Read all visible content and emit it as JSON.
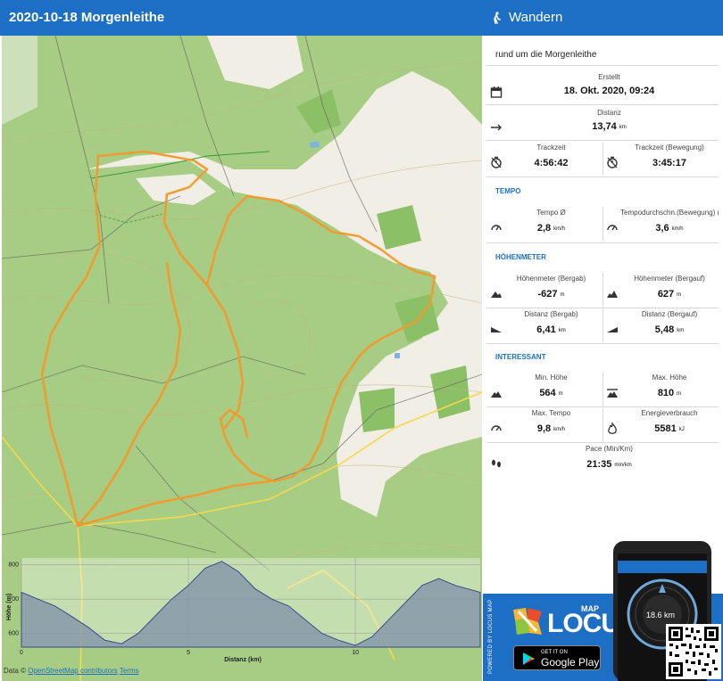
{
  "header": {
    "title": "2020-10-18 Morgenleithe",
    "activity": "Wandern"
  },
  "description": "rund um die Morgenleithe",
  "stats": {
    "created": {
      "label": "Erstellt",
      "value": "18. Okt. 2020, 09:24"
    },
    "distance": {
      "label": "Distanz",
      "value": "13,74",
      "unit": "km"
    },
    "tracktime": {
      "label": "Trackzeit",
      "value": "4:56:42"
    },
    "tracktime_moving": {
      "label": "Trackzeit (Bewegung)",
      "value": "3:45:17"
    }
  },
  "tempo": {
    "section": "TEMPO",
    "tempo": {
      "label": "Tempo Ø",
      "value": "2,8",
      "unit": "km/h"
    },
    "tempo_moving": {
      "label": "Tempodurchschn.(Bewegung) (B.",
      "value": "3,6",
      "unit": "km/h"
    }
  },
  "elevation": {
    "section": "HÖHENMETER",
    "descent": {
      "label": "Höhenmeter (Bergab)",
      "value": "-627",
      "unit": "m"
    },
    "ascent": {
      "label": "Höhenmeter (Bergauf)",
      "value": "627",
      "unit": "m"
    },
    "dist_down": {
      "label": "Distanz (Bergab)",
      "value": "6,41",
      "unit": "km"
    },
    "dist_up": {
      "label": "Distanz (Bergauf)",
      "value": "5,48",
      "unit": "km"
    }
  },
  "interesting": {
    "section": "INTERESSANT",
    "min_alt": {
      "label": "Min. Höhe",
      "value": "564",
      "unit": "m"
    },
    "max_alt": {
      "label": "Max. Höhe",
      "value": "810",
      "unit": "m"
    },
    "max_tempo": {
      "label": "Max. Tempo",
      "value": "9,8",
      "unit": "km/h"
    },
    "energy": {
      "label": "Energieverbrauch",
      "value": "5581",
      "unit": "kJ"
    },
    "pace": {
      "label": "Pace (Min/Km)",
      "value": "21:35",
      "unit": "min/km"
    }
  },
  "chart": {
    "ylabel": "Höhe (m)",
    "xlabel": "Distanz (km)",
    "yticks": [
      "800",
      "700",
      "600"
    ],
    "xticks": [
      "0",
      "5",
      "10"
    ]
  },
  "chart_data": {
    "type": "area",
    "title": "",
    "xlabel": "Distanz (km)",
    "ylabel": "Höhe (m)",
    "ylim": [
      560,
      820
    ],
    "xlim": [
      0,
      13.74
    ],
    "x": [
      0,
      0.5,
      1,
      1.5,
      2,
      2.5,
      3,
      3.5,
      4,
      4.5,
      5,
      5.5,
      6,
      6.5,
      7,
      7.5,
      8,
      8.5,
      9,
      9.5,
      10,
      10.5,
      11,
      11.5,
      12,
      12.5,
      13,
      13.74
    ],
    "values": [
      720,
      700,
      680,
      650,
      618,
      580,
      570,
      600,
      650,
      700,
      740,
      790,
      810,
      780,
      730,
      700,
      680,
      640,
      600,
      580,
      565,
      590,
      640,
      690,
      740,
      760,
      740,
      720
    ]
  },
  "attribution": {
    "prefix": "Data ©",
    "osm": "OpenStreetMap contributors",
    "terms": "Terms"
  },
  "promo": {
    "side_text": "POWERED BY LOCUS MAP",
    "logo": "LOCUS",
    "logo_small": "MAP",
    "store_line1": "GET IT ON",
    "store_line2": "Google Play",
    "phone_distance": "18.6 km"
  },
  "colors": {
    "accent": "#1c6fc4",
    "track": "#f29a2e",
    "elevation_fill": "#7d8fa8"
  }
}
